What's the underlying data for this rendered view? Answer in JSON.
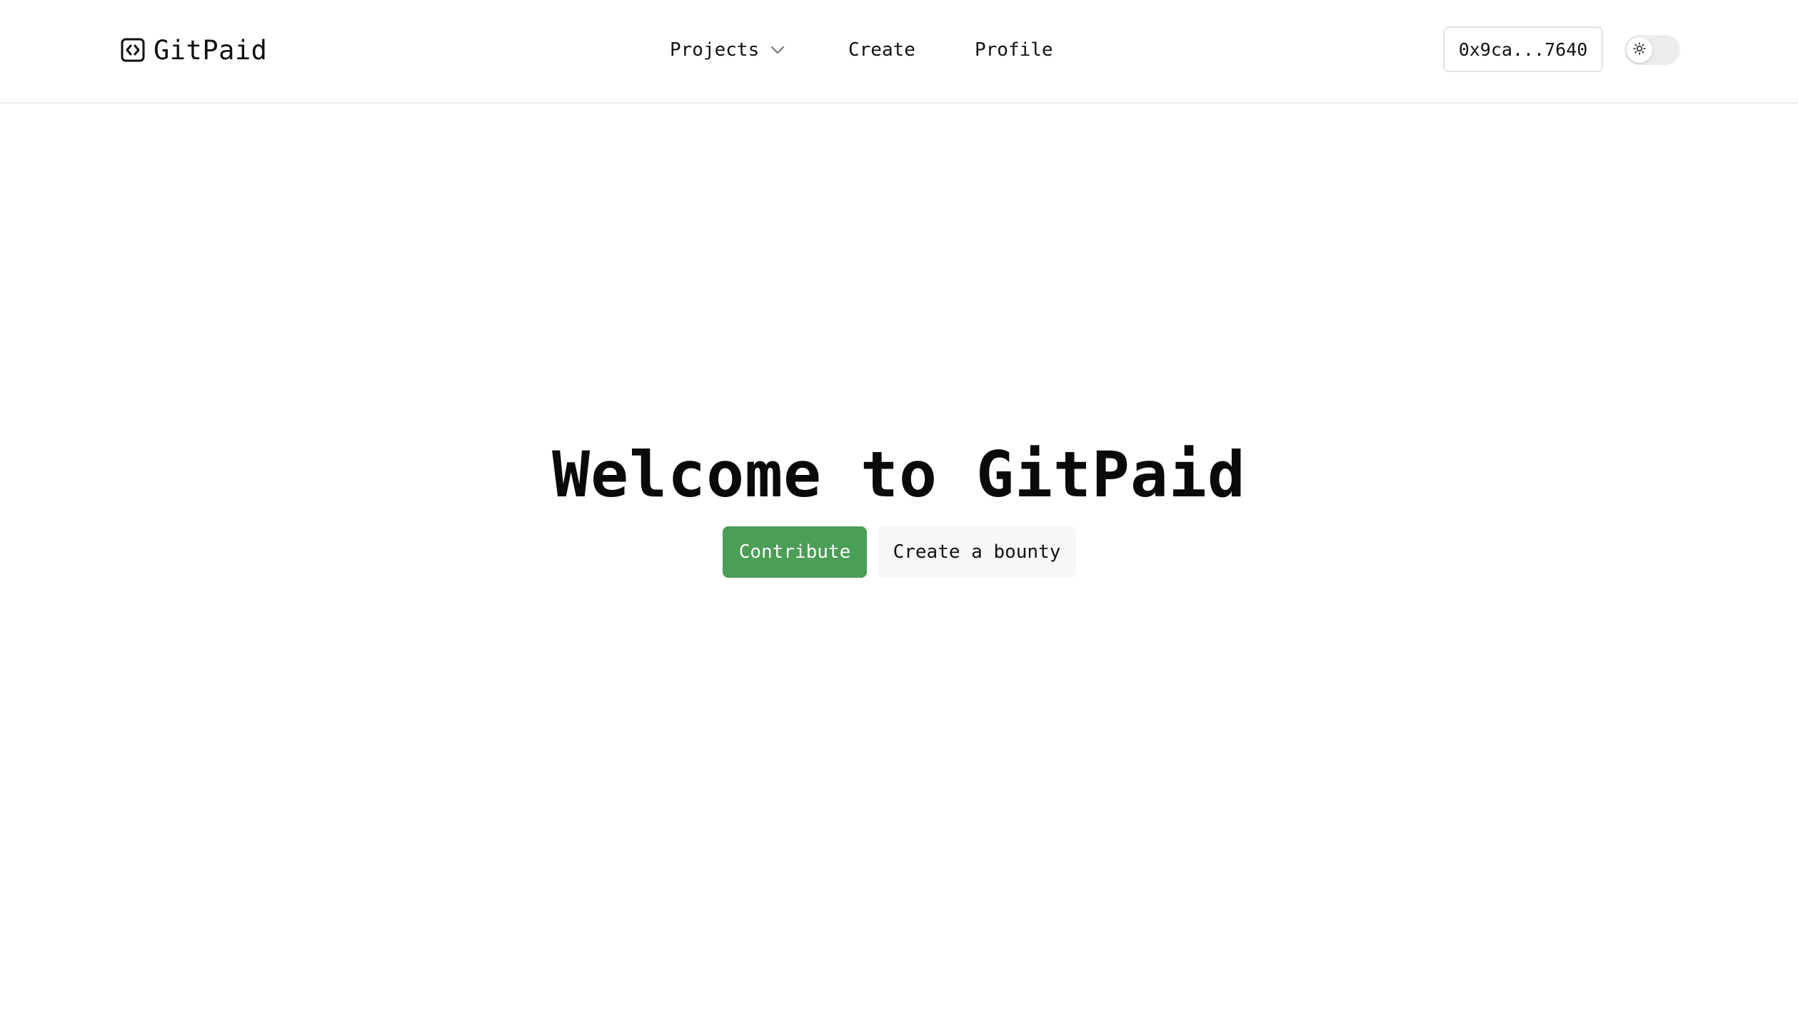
{
  "brand": {
    "name": "GitPaid",
    "icon": "code-bracket-icon"
  },
  "nav": {
    "projects_label": "Projects",
    "create_label": "Create",
    "profile_label": "Profile"
  },
  "wallet": {
    "address": "0x9ca...7640"
  },
  "theme": {
    "mode": "light",
    "icon": "sun-icon"
  },
  "hero": {
    "title": "Welcome to GitPaid",
    "primary_button": "Contribute",
    "secondary_button": "Create a bounty"
  },
  "colors": {
    "accent": "#4a9e55",
    "secondary_button_bg": "#f7f7f7",
    "border": "#ececec"
  }
}
